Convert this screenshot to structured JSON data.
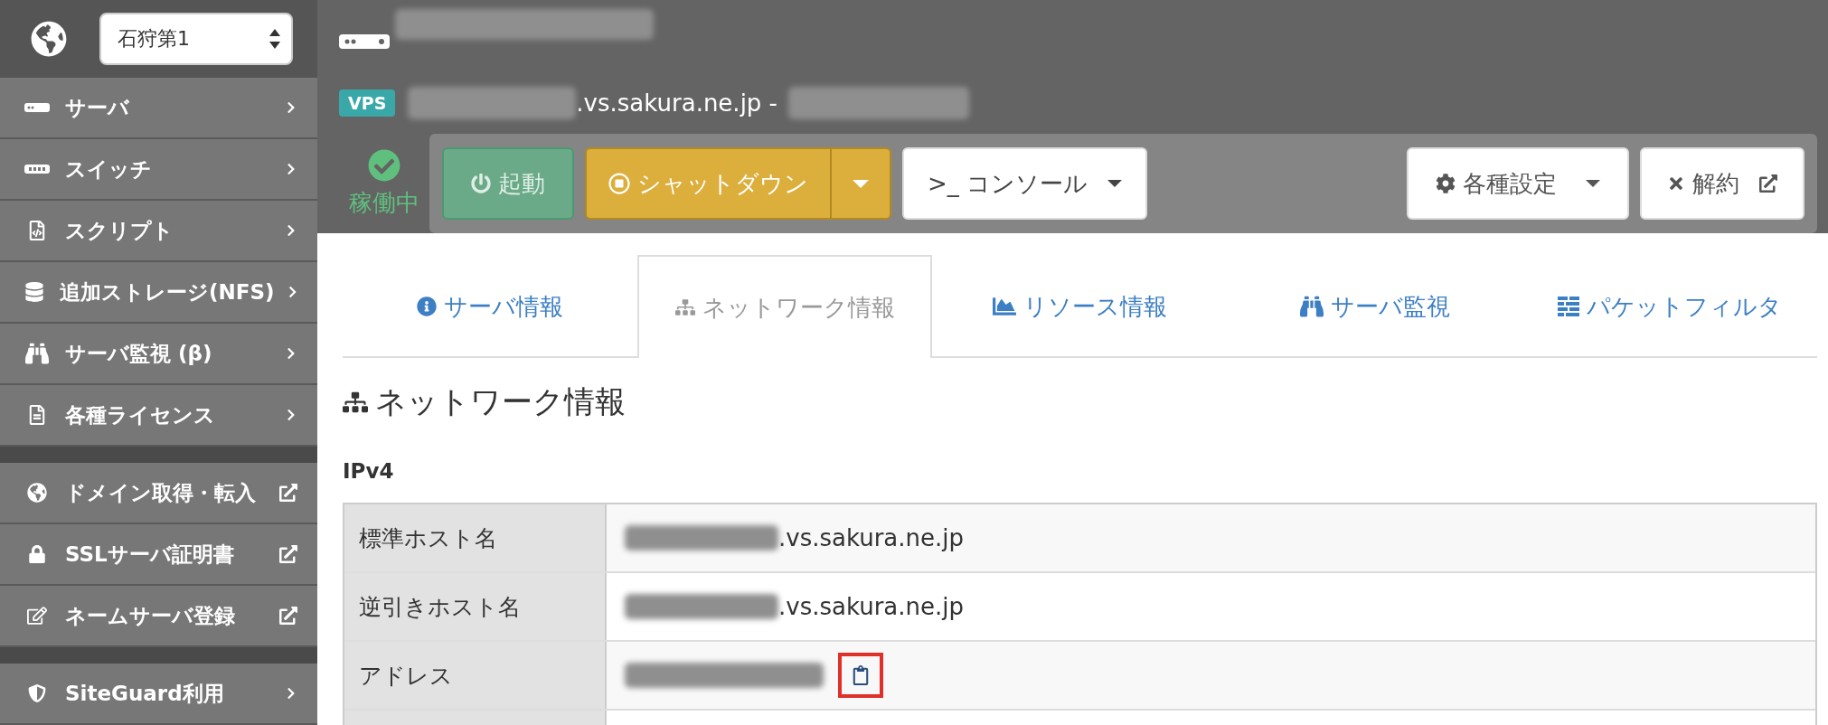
{
  "sidebar": {
    "region_select": {
      "value": "石狩第1"
    },
    "groups": [
      {
        "items": [
          {
            "label": "サーバ",
            "kind": "submenu"
          },
          {
            "label": "スイッチ",
            "kind": "submenu"
          },
          {
            "label": "スクリプト",
            "kind": "submenu"
          },
          {
            "label": "追加ストレージ(NFS)",
            "kind": "submenu"
          },
          {
            "label": "サーバ監視 (β)",
            "kind": "submenu"
          },
          {
            "label": "各種ライセンス",
            "kind": "submenu"
          }
        ]
      },
      {
        "items": [
          {
            "label": "ドメイン取得・転入",
            "kind": "external"
          },
          {
            "label": "SSLサーバ証明書",
            "kind": "external"
          },
          {
            "label": "ネームサーバ登録",
            "kind": "external"
          }
        ]
      },
      {
        "items": [
          {
            "label": "SiteGuard利用",
            "kind": "submenu"
          }
        ]
      }
    ]
  },
  "header": {
    "badge": "VPS",
    "hostname_suffix": ".vs.sakura.ne.jp -",
    "status": {
      "label": "稼働中",
      "running": true
    },
    "buttons": [
      {
        "label": "起動",
        "kind": "start",
        "disabled": true
      },
      {
        "label": "シャットダウン",
        "kind": "shutdown",
        "disabled": false
      },
      {
        "label": "コンソール",
        "kind": "console",
        "prompt": ">_",
        "disabled": false
      },
      {
        "label": "各種設定",
        "kind": "settings",
        "disabled": false
      },
      {
        "label": "解約",
        "kind": "cancel",
        "disabled": false
      }
    ]
  },
  "tabs": [
    {
      "label": "サーバ情報",
      "selected": false
    },
    {
      "label": "ネットワーク情報",
      "selected": true
    },
    {
      "label": "リソース情報",
      "selected": false
    },
    {
      "label": "サーバ監視",
      "selected": false
    },
    {
      "label": "パケットフィルタ",
      "selected": false
    }
  ],
  "section": {
    "title": "ネットワーク情報",
    "subtitle": "IPv4",
    "rows": [
      {
        "label": "標準ホスト名",
        "kind": "host",
        "value": ".vs.sakura.ne.jp"
      },
      {
        "label": "逆引きホスト名",
        "kind": "host",
        "value": ".vs.sakura.ne.jp"
      },
      {
        "label": "アドレス",
        "kind": "address",
        "copy_highlighted": true
      }
    ]
  }
}
